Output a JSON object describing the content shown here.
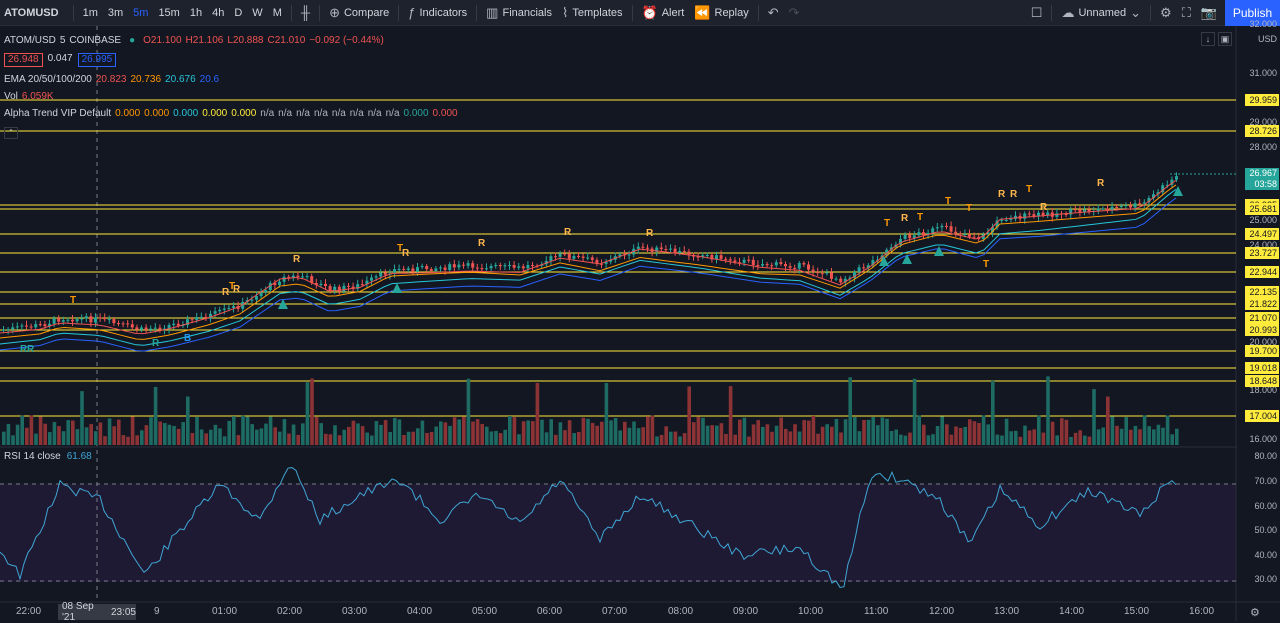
{
  "toolbar": {
    "symbol": "ATOMUSD",
    "intervals": [
      "1m",
      "3m",
      "5m",
      "15m",
      "1h",
      "4h",
      "D",
      "W",
      "M"
    ],
    "active_interval": "5m",
    "compare": "Compare",
    "indicators": "Indicators",
    "financials": "Financials",
    "templates": "Templates",
    "alert": "Alert",
    "replay": "Replay",
    "layout_name": "Unnamed",
    "publish": "Publish"
  },
  "legend": {
    "pair": "ATOM/USD",
    "interval": "5",
    "exchange": "COINBASE",
    "ohlc": {
      "o": "O21.100",
      "h": "H21.106",
      "l": "L20.888",
      "c": "C21.010",
      "chg": "−0.092 (−0.44%)"
    },
    "bid": "26.948",
    "spread": "0.047",
    "ask": "26.995",
    "ema_label": "EMA 20/50/100/200",
    "ema_values": [
      "20.823",
      "20.736",
      "20.676",
      "20.6"
    ],
    "vol_label": "Vol",
    "vol_value": "6.059K",
    "alpha_label": "Alpha Trend VIP Default",
    "alpha_values": [
      "0.000",
      "0.000",
      "0.000",
      "0.000",
      "0.000",
      "n/a",
      "n/a",
      "n/a",
      "n/a",
      "n/a",
      "n/a",
      "n/a",
      "n/a",
      "0.000",
      "0.000"
    ],
    "rsi_label": "RSI 14 close",
    "rsi_value": "61.68"
  },
  "price_axis": {
    "currency": "USD",
    "ticks": [
      "32.000",
      "31.000",
      "29.000",
      "28.000",
      "25.000",
      "24.000",
      "20.000",
      "18.000",
      "16.000"
    ],
    "hlines": [
      "29.959",
      "28.726",
      "26.925",
      "25.681",
      "24.497",
      "23.727",
      "22.944",
      "22.135",
      "21.822",
      "21.070",
      "20.993",
      "19.700",
      "19.018",
      "18.648",
      "17.004"
    ],
    "last_price": "26.967",
    "countdown": "03:58"
  },
  "rsi_axis": {
    "ticks": [
      "80.00",
      "70.00",
      "60.00",
      "50.00",
      "40.00",
      "30.00"
    ]
  },
  "time_axis": {
    "ticks": [
      "22:00",
      "9",
      "01:00",
      "02:00",
      "03:00",
      "04:00",
      "05:00",
      "06:00",
      "07:00",
      "08:00",
      "09:00",
      "10:00",
      "11:00",
      "12:00",
      "13:00",
      "14:00",
      "15:00",
      "16:00"
    ],
    "cursor_date": "08 Sep '21",
    "cursor_time": "23:05"
  },
  "signals": [
    "R",
    "R",
    "T",
    "R",
    "B",
    "R",
    "T",
    "R",
    "R",
    "T",
    "R",
    "R",
    "R",
    "R",
    "T",
    "R",
    "T",
    "T",
    "T",
    "T",
    "R",
    "R",
    "T",
    "R",
    "R"
  ],
  "colors": {
    "up": "#26a69a",
    "down": "#ef5350",
    "hline": "#ffeb3b",
    "rsi": "#7e57c2",
    "accent": "#2962ff"
  }
}
